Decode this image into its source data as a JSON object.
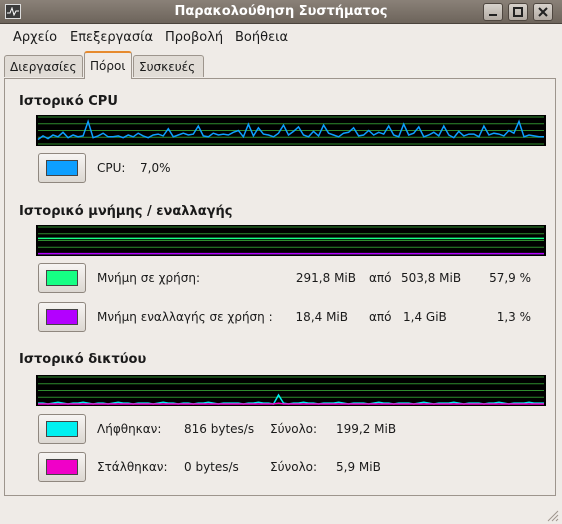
{
  "window": {
    "title": "Παρακολούθηση Συστήματος"
  },
  "menu": [
    "Αρχείο",
    "Επεξεργασία",
    "Προβολή",
    "Βοήθεια"
  ],
  "tabs": [
    "Διεργασίες",
    "Πόροι",
    "Συσκευές"
  ],
  "colors": {
    "cpu": "#0d9fff",
    "memory": "#16ff84",
    "swap": "#b300ff",
    "received": "#00f0f0",
    "sent": "#f000c8",
    "grid": "#2e8b2e"
  },
  "cpu": {
    "title": "Ιστορικό CPU",
    "label": "CPU:",
    "value": "7,0%",
    "history": [
      5,
      9,
      6,
      10,
      8,
      13,
      7,
      10,
      8,
      9,
      25,
      7,
      9,
      12,
      8,
      8,
      9,
      7,
      10,
      8,
      12,
      9,
      7,
      10,
      11,
      9,
      17,
      8,
      10,
      12,
      10,
      11,
      20,
      9,
      8,
      12,
      10,
      11,
      10,
      13,
      15,
      8,
      22,
      9,
      18,
      11,
      10,
      8,
      12,
      21,
      10,
      14,
      19,
      10,
      8,
      14,
      9,
      21,
      12,
      10,
      8,
      12,
      13,
      18,
      9,
      10,
      15,
      10,
      13,
      11,
      20,
      10,
      8,
      22,
      10,
      12,
      19,
      8,
      10,
      13,
      9,
      20,
      10,
      7,
      14,
      9,
      11,
      11,
      8,
      20,
      10,
      12,
      11,
      9,
      15,
      12,
      25,
      8,
      10,
      9,
      8,
      8
    ]
  },
  "memory": {
    "title": "Ιστορικό μνήμης / εναλλαγής",
    "mem_label": "Μνήμη σε χρήση:",
    "mem_used": "291,8 MiB",
    "mem_of": "από",
    "mem_total": "503,8 MiB",
    "mem_percent": "57,9 %",
    "mem_fraction": 0.579,
    "swap_label": "Μνήμη εναλλαγής σε χρήση :",
    "swap_used": "18,4 MiB",
    "swap_of": "από",
    "swap_total": "1,4 GiB",
    "swap_percent": "1,3 %",
    "swap_fraction": 0.013
  },
  "network": {
    "title": "Ιστορικό δικτύου",
    "recv_label": "Λήφθηκαν:",
    "recv_rate": "816 bytes/s",
    "recv_total_label": "Σύνολο:",
    "recv_total": "199,2 MiB",
    "sent_label": "Στάλθηκαν:",
    "sent_rate": "0 bytes/s",
    "sent_total_label": "Σύνολο:",
    "sent_total": "5,9 MiB",
    "recv_history": [
      1,
      1,
      0,
      1,
      2,
      1,
      0,
      1,
      1,
      2,
      1,
      0,
      1,
      1,
      0,
      1,
      2,
      1,
      1,
      0,
      1,
      1,
      1,
      0,
      1,
      2,
      1,
      1,
      0,
      1,
      1,
      0,
      1,
      1,
      2,
      1,
      0,
      1,
      1,
      1,
      1,
      0,
      1,
      1,
      2,
      1,
      1,
      0,
      10,
      1,
      0,
      1,
      1,
      2,
      1,
      1,
      0,
      1,
      1,
      1,
      2,
      1,
      0,
      1,
      1,
      1,
      0,
      1,
      2,
      1,
      1,
      0,
      1,
      1,
      1,
      0,
      1,
      2,
      1,
      0,
      1,
      1,
      1,
      2,
      1,
      0,
      1,
      1,
      1,
      0,
      1,
      1,
      2,
      1,
      0,
      1,
      1,
      1,
      2,
      1,
      1,
      1
    ],
    "sent_history": [
      0,
      0,
      0,
      0,
      0,
      0,
      0,
      0,
      0,
      0,
      0,
      0,
      0,
      0,
      0,
      0,
      0,
      0,
      0,
      0,
      0,
      0,
      0,
      0,
      0,
      0,
      0,
      0,
      0,
      0,
      0,
      0,
      0,
      0,
      0,
      0,
      0,
      0,
      0,
      0,
      0,
      0,
      0,
      0,
      0,
      0,
      0,
      0,
      1,
      0,
      0,
      0,
      0,
      0,
      0,
      0,
      0,
      0,
      0,
      0,
      0,
      0,
      0,
      0,
      0,
      0,
      0,
      0,
      0,
      0,
      0,
      0,
      0,
      0,
      0,
      0,
      0,
      0,
      0,
      0,
      0,
      0,
      0,
      0,
      0,
      0,
      0,
      0,
      0,
      0,
      0,
      0,
      0,
      0,
      0,
      0,
      0,
      0,
      0,
      0,
      0,
      0
    ]
  }
}
